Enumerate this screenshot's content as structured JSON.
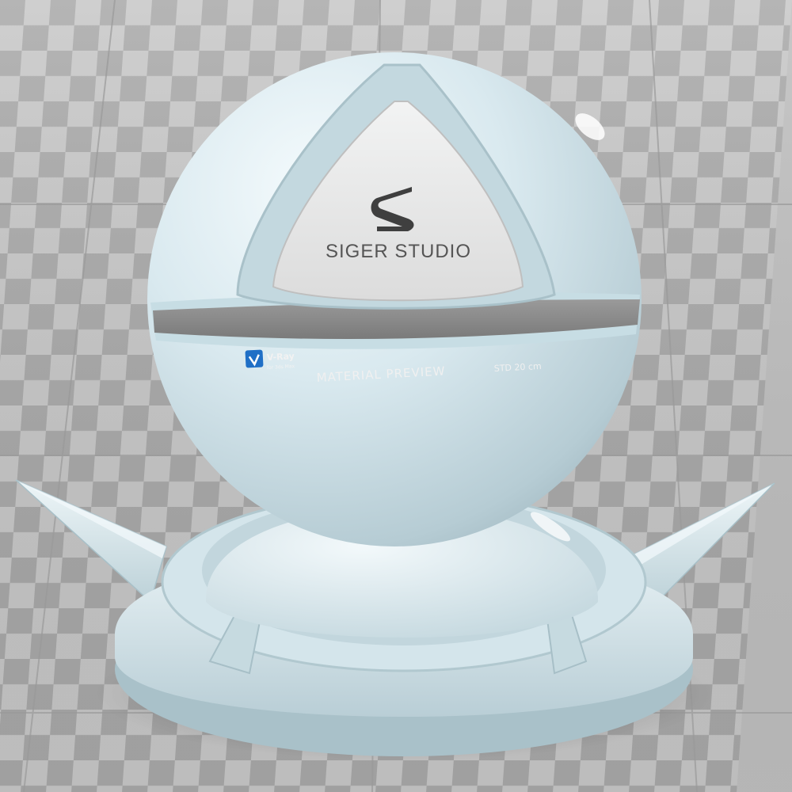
{
  "preview": {
    "studio_name": "SIGER STUDIO",
    "logo_letter": "S",
    "band_label": "MATERIAL PREVIEW",
    "scale_label": "STD 20 cm",
    "renderer_name": "V-Ray",
    "renderer_sub": "for 3ds Max",
    "renderer_icon": "vray-logo-icon"
  },
  "material": {
    "base_color": "#d6e6ec",
    "highlight_color": "#f4fafc",
    "shadow_color": "#9fb7c0",
    "band_color": "#8f8f8f"
  },
  "floor": {
    "light_tile": "#c9c9c9",
    "dark_tile": "#a9a9a9"
  }
}
